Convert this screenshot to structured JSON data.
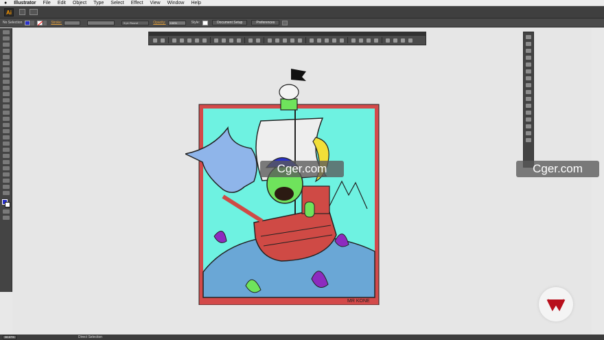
{
  "menubar": {
    "apple": "",
    "app_name": "Illustrator",
    "items": [
      "File",
      "Edit",
      "Object",
      "Type",
      "Select",
      "Effect",
      "View",
      "Window",
      "Help"
    ]
  },
  "appbar": {
    "logo_text": "Ai"
  },
  "control": {
    "selection": "No Selection",
    "stroke_label": "Stroke:",
    "stroke_profile": "5 pt. Round",
    "opacity_label": "Opacity:",
    "opacity_value": "100%",
    "style_label": "Style:",
    "document_setup": "Document Setup",
    "preferences": "Preferences"
  },
  "watermarks": [
    "Cger.com",
    "Cger.com"
  ],
  "artwork": {
    "signature": "MR KONE"
  },
  "status": {
    "zoom": "66.67%",
    "selection_tool": "Direct Selection"
  },
  "colors": {
    "ui_dark": "#3f3f3f",
    "canvas": "#e6e6e6",
    "frame_red": "#d34a4a",
    "sea_blue": "#6aa7d6",
    "sky_cyan": "#6ef2e1",
    "ship_red": "#cf4a45",
    "alien_green": "#6fe35c",
    "purple": "#8d2bbf",
    "hat_blue": "#2a31c9"
  },
  "icons": {
    "apple": "apple-icon",
    "badge": "brand-badge-icon"
  }
}
